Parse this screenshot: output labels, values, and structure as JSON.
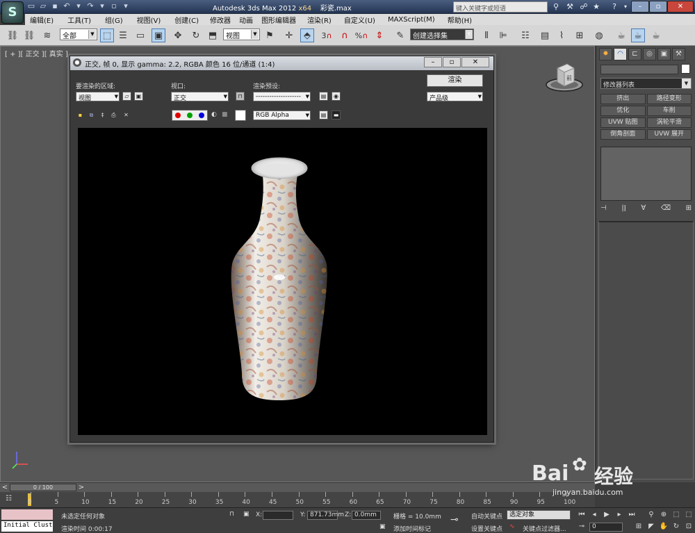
{
  "app": {
    "logo": "S",
    "title": "Autodesk 3ds Max  2012",
    "arch": "x64",
    "file": "彩瓷.max",
    "search_placeholder": "键入关键字或短语"
  },
  "menu": [
    "编辑(E)",
    "工具(T)",
    "组(G)",
    "视图(V)",
    "创建(C)",
    "修改器",
    "动画",
    "图形编辑器",
    "渲染(R)",
    "自定义(U)",
    "MAXScript(M)",
    "帮助(H)"
  ],
  "toolbar": {
    "filter": "全部",
    "view_dropdown": "视图",
    "selection_set": "创建选择集",
    "snap_3": "3",
    "snap_2_5": "2.5"
  },
  "viewport": {
    "label": "[ + ][ 正交 ][ 真实 ]",
    "viewcube_label": "前"
  },
  "render_window": {
    "title": "正交, 帧 0, 显示 gamma: 2.2, RGBA 颜色 16 位/通道 (1:4)",
    "area_label": "要渲染的区域:",
    "area_value": "视图",
    "viewport_label": "视口:",
    "viewport_value": "正交",
    "preset_label": "渲染预设:",
    "preset_value": "--------------------",
    "render_button": "渲染",
    "quality_value": "产品级",
    "channel_value": "RGB Alpha",
    "channels": [
      {
        "name": "red",
        "color": "#e00000"
      },
      {
        "name": "green",
        "color": "#00a000"
      },
      {
        "name": "blue",
        "color": "#0000e0"
      }
    ]
  },
  "command_panel": {
    "modifier_list": "修改器列表",
    "buttons": [
      "挤出",
      "路径变形",
      "优化",
      "车削",
      "UVW 贴图",
      "涡轮平滑",
      "倒角剖面",
      "UVW 展开"
    ]
  },
  "timeline": {
    "frame_display": "0 / 100",
    "ticks": [
      "0",
      "5",
      "10",
      "15",
      "20",
      "25",
      "30",
      "35",
      "40",
      "45",
      "50",
      "55",
      "60",
      "65",
      "70",
      "75",
      "80",
      "85",
      "90",
      "95",
      "100"
    ]
  },
  "status": {
    "maxscript_text": "Initial Cluster",
    "prompt": "未选定任何对象",
    "render_time": "渲染时间  0:00:17",
    "x_label": "X:",
    "x_value": "",
    "y_label": "Y:",
    "y_value": "871.73mm",
    "z_label": "Z:",
    "z_value": "0.0mm",
    "grid": "栅格 = 10.0mm",
    "add_time_tag": "添加时间标记",
    "auto_key": "自动关键点",
    "set_key": "设置关键点",
    "selected": "选定对象",
    "key_filters": "关键点过滤器...",
    "frame_value": "0"
  },
  "watermark": {
    "brand": "Bai",
    "brand2": "经验",
    "url": "jingyan.baidu.com"
  }
}
